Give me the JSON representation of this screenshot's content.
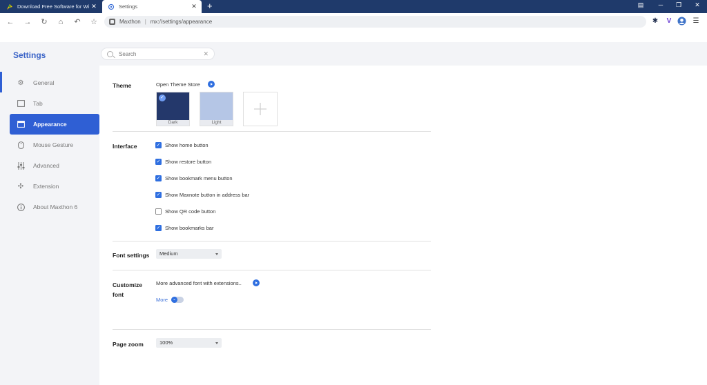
{
  "browser": {
    "tabs": [
      {
        "title": "Download Free Software for Wind",
        "active": false
      },
      {
        "title": "Settings",
        "active": true
      }
    ],
    "new_tab": "+",
    "address": {
      "site": "Maxthon",
      "separator": "|",
      "url": "mx://settings/appearance"
    }
  },
  "sidebar": {
    "title": "Settings",
    "items": [
      {
        "label": "General",
        "icon": "gear-icon",
        "active": false
      },
      {
        "label": "Tab",
        "icon": "tab-icon",
        "active": false
      },
      {
        "label": "Appearance",
        "icon": "appearance-icon",
        "active": true
      },
      {
        "label": "Mouse Gesture",
        "icon": "mouse-icon",
        "active": false
      },
      {
        "label": "Advanced",
        "icon": "sliders-icon",
        "active": false
      },
      {
        "label": "Extension",
        "icon": "puzzle-icon",
        "active": false
      },
      {
        "label": "About Maxthon 6",
        "icon": "info-icon",
        "active": false
      }
    ]
  },
  "search": {
    "placeholder": "Search",
    "value": ""
  },
  "theme": {
    "label": "Theme",
    "store_link": "Open Theme Store",
    "themes": [
      {
        "name": "Dark",
        "color": "#24386b",
        "selected": true
      },
      {
        "name": "Light",
        "color": "#b5c6e6",
        "selected": false
      }
    ]
  },
  "interface": {
    "label": "Interface",
    "options": [
      {
        "label": "Show home button",
        "checked": true
      },
      {
        "label": "Show restore button",
        "checked": true
      },
      {
        "label": "Show bookmark menu button",
        "checked": true
      },
      {
        "label": "Show Maxnote button in address bar",
        "checked": true
      },
      {
        "label": "Show QR code button",
        "checked": false
      },
      {
        "label": "Show bookmarks bar",
        "checked": true
      }
    ]
  },
  "font_settings": {
    "label": "Font settings",
    "value": "Medium"
  },
  "customize_font": {
    "label_line1": "Customize",
    "label_line2": "font",
    "link": "More advanced font with extensions..",
    "more": "More"
  },
  "page_zoom": {
    "label": "Page zoom",
    "value": "100%"
  },
  "colors": {
    "accent": "#2f5fd4",
    "titlebar": "#1f3a6b",
    "sidebar_bg": "#f3f4f7"
  }
}
